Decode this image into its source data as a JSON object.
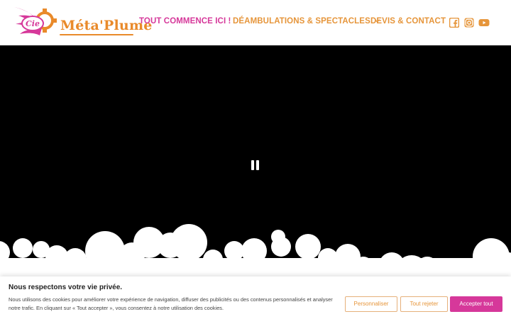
{
  "header": {
    "logo": {
      "badge_text": "Cie",
      "name": "Méta'Plume"
    },
    "nav": [
      {
        "label": "TOUT COMMENCE ICI !"
      },
      {
        "label": "DÉAMBULATIONS & SPECTACLES"
      },
      {
        "label": "DEVIS & CONTACT"
      }
    ],
    "social": [
      {
        "icon": "facebook-icon"
      },
      {
        "icon": "instagram-icon"
      },
      {
        "icon": "youtube-icon"
      }
    ]
  },
  "video": {
    "state": "playing",
    "control_icon": "pause-icon"
  },
  "cookie": {
    "title": "Nous respectons votre vie privée.",
    "text": "Nous utilisons des cookies pour améliorer votre expérience de navigation, diffuser des publicités ou des contenus personnalisés et analyser notre trafic. En cliquant sur « Tout accepter », vous consentez à notre utilisation des cookies.",
    "buttons": {
      "customize": "Personnaliser",
      "reject": "Tout rejeter",
      "accept": "Accepter tout"
    }
  },
  "colors": {
    "brand_pink": "#d6389a",
    "brand_orange": "#e6953a",
    "video_bg": "#000000"
  }
}
